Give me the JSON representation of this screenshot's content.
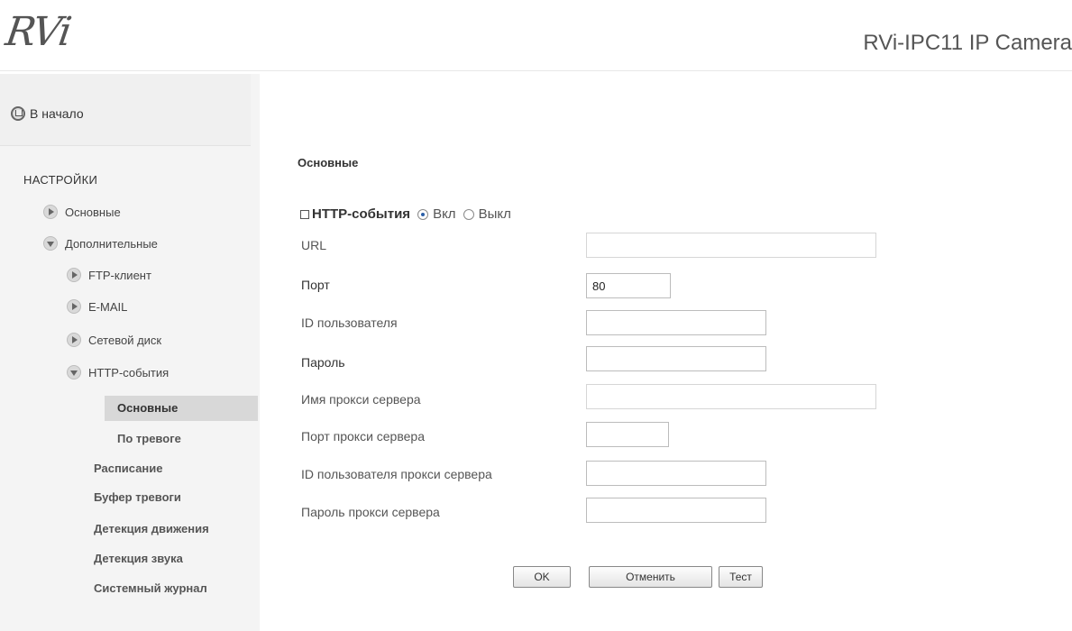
{
  "header": {
    "logo_text": "RVi",
    "app_title": "RVi-IPC11 IP Camera"
  },
  "sidebar": {
    "home_label": "В начало",
    "section_title": "НАСТРОЙКИ",
    "items": [
      {
        "label": "Основные"
      },
      {
        "label": "Дополнительные"
      },
      {
        "label": "FTP-клиент"
      },
      {
        "label": "E-MAIL"
      },
      {
        "label": "Сетевой диск"
      },
      {
        "label": "HTTP-события"
      },
      {
        "label": "Основные"
      },
      {
        "label": "По тревоге"
      },
      {
        "label": "Расписание"
      },
      {
        "label": "Буфер тревоги"
      },
      {
        "label": "Детекция движения"
      },
      {
        "label": "Детекция звука"
      },
      {
        "label": "Системный журнал"
      }
    ]
  },
  "main": {
    "title": "Основные",
    "http_events": {
      "label": "HTTP-события",
      "on_label": "Вкл",
      "off_label": "Выкл",
      "selected": "Вкл"
    },
    "fields": {
      "url": {
        "label": "URL",
        "value": ""
      },
      "port": {
        "label": "Порт",
        "value": "80"
      },
      "user_id": {
        "label": "ID пользователя",
        "value": ""
      },
      "password": {
        "label": "Пароль",
        "value": ""
      },
      "proxy_name": {
        "label": "Имя прокси сервера",
        "value": ""
      },
      "proxy_port": {
        "label": "Порт прокси сервера",
        "value": ""
      },
      "proxy_user_id": {
        "label": "ID пользователя прокси сервера",
        "value": ""
      },
      "proxy_password": {
        "label": "Пароль прокси сервера",
        "value": ""
      }
    },
    "buttons": {
      "ok": "OK",
      "cancel": "Отменить",
      "test": "Тест"
    }
  }
}
